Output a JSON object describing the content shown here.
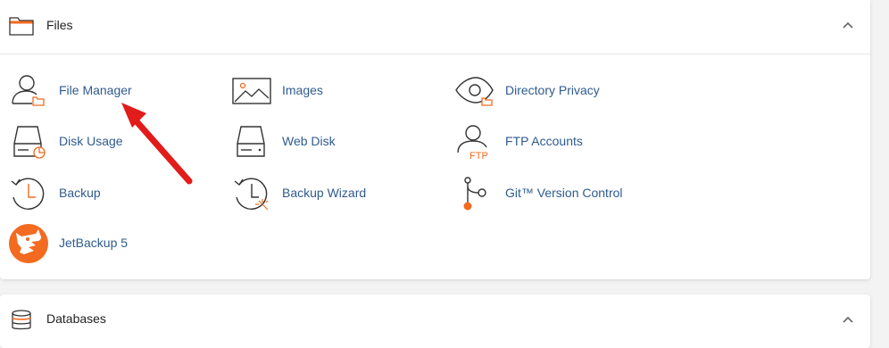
{
  "files_panel": {
    "title": "Files",
    "collapse_icon": "chevron-up-icon",
    "items": [
      {
        "label": "File Manager",
        "icon": "file-manager-icon"
      },
      {
        "label": "Images",
        "icon": "images-icon"
      },
      {
        "label": "Directory Privacy",
        "icon": "directory-privacy-icon"
      },
      {
        "label": "Disk Usage",
        "icon": "disk-usage-icon"
      },
      {
        "label": "Web Disk",
        "icon": "web-disk-icon"
      },
      {
        "label": "FTP Accounts",
        "icon": "ftp-accounts-icon"
      },
      {
        "label": "Backup",
        "icon": "backup-icon"
      },
      {
        "label": "Backup Wizard",
        "icon": "backup-wizard-icon"
      },
      {
        "label": "Git™ Version Control",
        "icon": "git-icon"
      },
      {
        "label": "JetBackup 5",
        "icon": "jetbackup-icon"
      }
    ],
    "ftp_badge": "FTP"
  },
  "databases_panel": {
    "title": "Databases",
    "collapse_icon": "chevron-up-icon"
  },
  "annotation": {
    "icon": "red-arrow-icon",
    "color": "#e21b1b"
  },
  "colors": {
    "accent": "#f26b21",
    "link": "#2f5b8f",
    "icon_stroke": "#333333"
  }
}
